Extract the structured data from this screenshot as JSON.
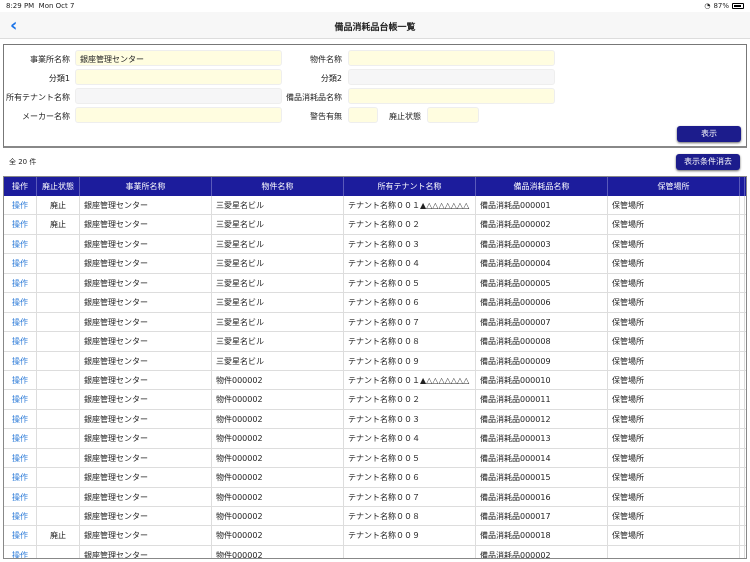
{
  "status": {
    "time": "8:29 PM",
    "date": "Mon Oct 7",
    "battery": "87%"
  },
  "nav": {
    "title": "備品消耗品台帳一覧"
  },
  "filter": {
    "office_label": "事業所名称",
    "office_value": "銀座管理センター",
    "property_label": "物件名称",
    "property_value": "",
    "cat1_label": "分類1",
    "cat1_value": "",
    "cat2_label": "分類2",
    "cat2_value": "",
    "tenant_label": "所有テナント名称",
    "tenant_value": "",
    "item_label": "備品消耗品名称",
    "item_value": "",
    "maker_label": "メーカー名称",
    "maker_value": "",
    "warning_label": "警告有無",
    "warning_value": "",
    "disposal_label": "廃止状態",
    "disposal_value": "",
    "show_label": "表示"
  },
  "count": "全 20 件",
  "clear_label": "表示条件消去",
  "columns": [
    "操作",
    "廃止状態",
    "事業所名称",
    "物件名称",
    "所有テナント名称",
    "備品消耗品名称",
    "保管場所"
  ],
  "rows": [
    [
      "操作",
      "廃止",
      "銀座管理センター",
      "三愛星名ビル",
      "テナント名称００１▲△△△△△△△",
      "備品消耗品000001",
      "保管場所"
    ],
    [
      "操作",
      "廃止",
      "銀座管理センター",
      "三愛星名ビル",
      "テナント名称００２",
      "備品消耗品000002",
      "保管場所"
    ],
    [
      "操作",
      "",
      "銀座管理センター",
      "三愛星名ビル",
      "テナント名称００３",
      "備品消耗品000003",
      "保管場所"
    ],
    [
      "操作",
      "",
      "銀座管理センター",
      "三愛星名ビル",
      "テナント名称００４",
      "備品消耗品000004",
      "保管場所"
    ],
    [
      "操作",
      "",
      "銀座管理センター",
      "三愛星名ビル",
      "テナント名称００５",
      "備品消耗品000005",
      "保管場所"
    ],
    [
      "操作",
      "",
      "銀座管理センター",
      "三愛星名ビル",
      "テナント名称００６",
      "備品消耗品000006",
      "保管場所"
    ],
    [
      "操作",
      "",
      "銀座管理センター",
      "三愛星名ビル",
      "テナント名称００７",
      "備品消耗品000007",
      "保管場所"
    ],
    [
      "操作",
      "",
      "銀座管理センター",
      "三愛星名ビル",
      "テナント名称００８",
      "備品消耗品000008",
      "保管場所"
    ],
    [
      "操作",
      "",
      "銀座管理センター",
      "三愛星名ビル",
      "テナント名称００９",
      "備品消耗品000009",
      "保管場所"
    ],
    [
      "操作",
      "",
      "銀座管理センター",
      "物件000002",
      "テナント名称００１▲△△△△△△△",
      "備品消耗品000010",
      "保管場所"
    ],
    [
      "操作",
      "",
      "銀座管理センター",
      "物件000002",
      "テナント名称００２",
      "備品消耗品000011",
      "保管場所"
    ],
    [
      "操作",
      "",
      "銀座管理センター",
      "物件000002",
      "テナント名称００３",
      "備品消耗品000012",
      "保管場所"
    ],
    [
      "操作",
      "",
      "銀座管理センター",
      "物件000002",
      "テナント名称００４",
      "備品消耗品000013",
      "保管場所"
    ],
    [
      "操作",
      "",
      "銀座管理センター",
      "物件000002",
      "テナント名称００５",
      "備品消耗品000014",
      "保管場所"
    ],
    [
      "操作",
      "",
      "銀座管理センター",
      "物件000002",
      "テナント名称００６",
      "備品消耗品000015",
      "保管場所"
    ],
    [
      "操作",
      "",
      "銀座管理センター",
      "物件000002",
      "テナント名称００７",
      "備品消耗品000016",
      "保管場所"
    ],
    [
      "操作",
      "",
      "銀座管理センター",
      "物件000002",
      "テナント名称００８",
      "備品消耗品000017",
      "保管場所"
    ],
    [
      "操作",
      "廃止",
      "銀座管理センター",
      "物件000002",
      "テナント名称００９",
      "備品消耗品000018",
      "保管場所"
    ],
    [
      "操作",
      "",
      "銀座管理センター",
      "物件000002",
      "",
      "備品消耗品000002",
      ""
    ]
  ]
}
